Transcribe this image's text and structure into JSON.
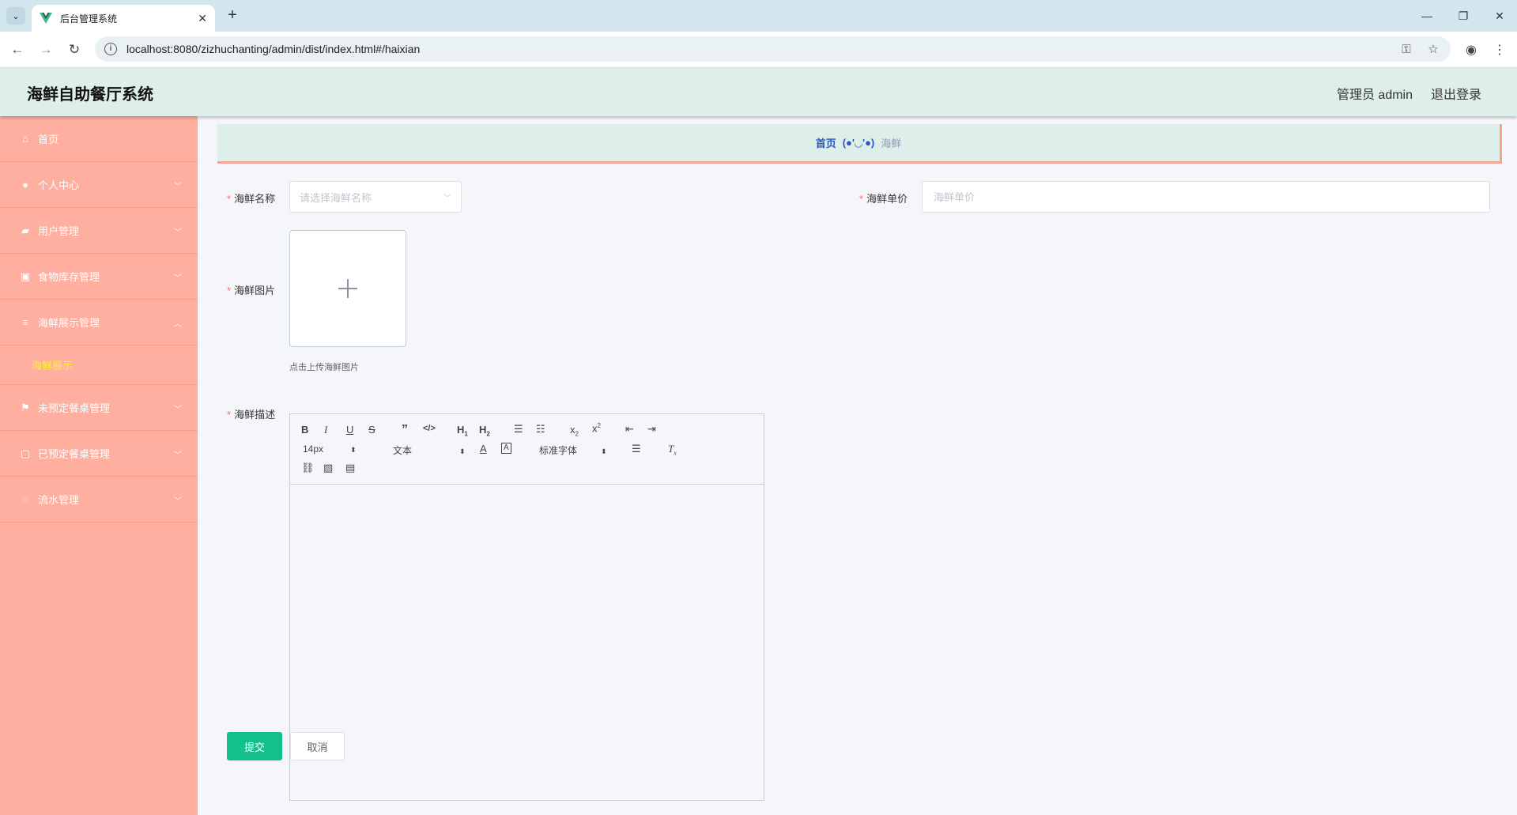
{
  "browser": {
    "tab_title": "后台管理系统",
    "tab_close": "✕",
    "new_tab": "+",
    "url": "localhost:8080/zizhuchanting/admin/dist/index.html#/haixian",
    "controls": {
      "minimize": "—",
      "restore": "❐",
      "close": "✕"
    },
    "icons": {
      "back": "arrow-left-icon",
      "forward": "arrow-right-icon",
      "reload": "reload-icon",
      "key": "key-icon",
      "star": "star-icon",
      "profile": "profile-icon",
      "menu": "more-vert-icon"
    }
  },
  "header": {
    "title": "海鲜自助餐厅系统",
    "admin": "管理员 admin",
    "logout": "退出登录"
  },
  "sidebar": {
    "items": [
      {
        "label": "首页",
        "icon": "home-icon",
        "glyph": "⌂"
      },
      {
        "label": "个人中心",
        "icon": "user-icon",
        "glyph": "👤",
        "arrow": "down"
      },
      {
        "label": "用户管理",
        "icon": "briefcase-icon",
        "glyph": "▰",
        "arrow": "down"
      },
      {
        "label": "食物库存管理",
        "icon": "box-icon",
        "glyph": "▣",
        "arrow": "down"
      },
      {
        "label": "海鲜展示管理",
        "icon": "sliders-icon",
        "glyph": "≡",
        "arrow": "up"
      },
      {
        "label": "未预定餐桌管理",
        "icon": "flag-icon",
        "glyph": "⚑",
        "arrow": "down"
      },
      {
        "label": "已预定餐桌管理",
        "icon": "chat-icon",
        "glyph": "▢",
        "arrow": "down"
      },
      {
        "label": "流水管理",
        "icon": "bell-off-icon",
        "glyph": "◌",
        "arrow": "down"
      }
    ],
    "sub_active": "海鲜展示"
  },
  "breadcrumb": {
    "home": "首页",
    "face": "(●'◡'●)",
    "current": "海鲜"
  },
  "form": {
    "name_label": "海鲜名称",
    "name_placeholder": "请选择海鲜名称",
    "price_label": "海鲜单价",
    "price_placeholder": "海鲜单价",
    "image_label": "海鲜图片",
    "upload_tip": "点击上传海鲜图片",
    "desc_label": "海鲜描述",
    "submit": "提交",
    "cancel": "取消",
    "required_mark": "*"
  },
  "editor": {
    "font_size": "14px",
    "header_select": "文本",
    "font_family": "标准字体"
  },
  "colors": {
    "sidebar_bg": "#ffaf9f",
    "header_bg": "#deeee8",
    "active_sub": "#ffee3a",
    "submit_bg": "#13c08a",
    "breadcrumb_link": "#2b56c5"
  }
}
